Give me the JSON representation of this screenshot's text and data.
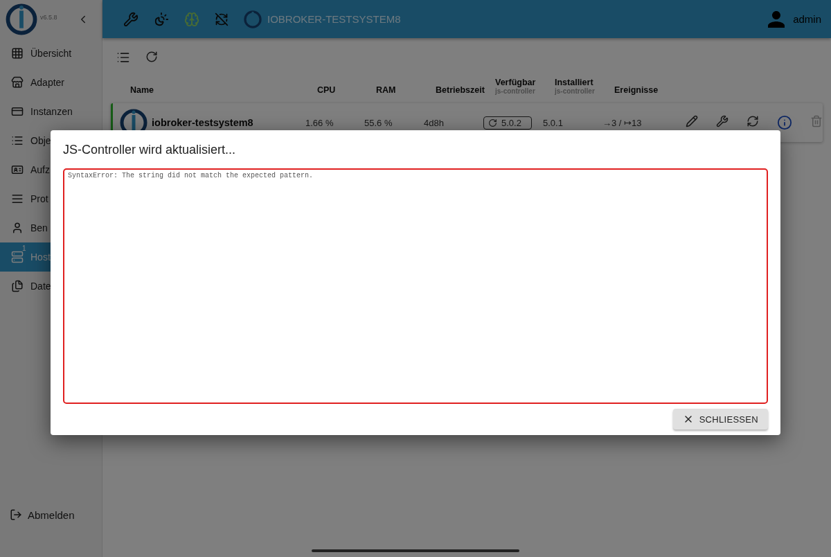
{
  "sidebar": {
    "version": "v6.5.8",
    "items": [
      {
        "label": "Übersicht",
        "selected": false
      },
      {
        "label": "Adapter",
        "selected": false
      },
      {
        "label": "Instanzen",
        "selected": false
      },
      {
        "label": "Obje",
        "selected": false
      },
      {
        "label": "Aufz",
        "selected": false
      },
      {
        "label": "Prot",
        "selected": false
      },
      {
        "label": "Ben",
        "selected": false
      },
      {
        "label": "Host",
        "selected": true,
        "badge": "1"
      },
      {
        "label": "Date",
        "selected": false
      }
    ],
    "logout": "Abmelden"
  },
  "topbar": {
    "host": "IOBROKER-TESTSYSTEM8",
    "user": "admin"
  },
  "hosts_table": {
    "columns": [
      {
        "label": "Name"
      },
      {
        "label": "CPU"
      },
      {
        "label": "RAM"
      },
      {
        "label": "Betriebszeit"
      },
      {
        "label": "Verfügbar",
        "sublabel": "js-controller"
      },
      {
        "label": "Installiert",
        "sublabel": "js-controller"
      },
      {
        "label": "Ereignisse"
      }
    ],
    "rows": [
      {
        "name": "iobroker-testsystem8",
        "cpu": "1.66 %",
        "ram": "55.6 %",
        "uptime": "4d8h",
        "available": "5.0.2",
        "installed": "5.0.1",
        "events": "→3 / ↦13"
      }
    ]
  },
  "dialog": {
    "title": "JS-Controller wird aktualisiert...",
    "log": "SyntaxError: The string did not match the expected pattern.",
    "button": "SCHLIESSEN"
  }
}
